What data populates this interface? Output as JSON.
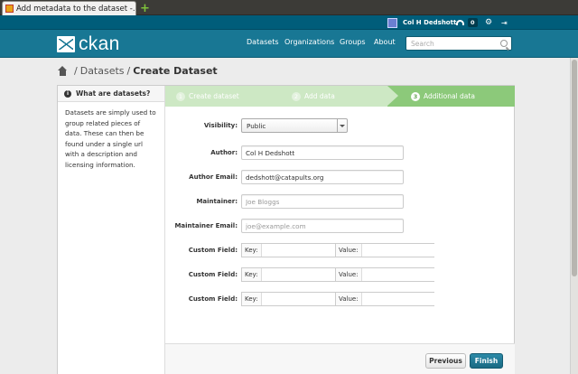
{
  "browser": {
    "tab_title": "Add metadata to the dataset -...",
    "new_tab_icon": "plus-icon"
  },
  "account": {
    "user_name": "Col H Dedshott",
    "dashboard_count": "0",
    "icons": [
      "avatar",
      "dashboard-icon",
      "gear-icon",
      "sign-out-icon"
    ]
  },
  "masthead": {
    "logo_text": "ckan",
    "nav": [
      "Datasets",
      "Organizations",
      "Groups",
      "About"
    ],
    "search_placeholder": "Search"
  },
  "breadcrumb": {
    "items": [
      "Datasets",
      "Create Dataset"
    ]
  },
  "aside": {
    "heading": "What are datasets?",
    "body": "Datasets are simply used to group related pieces of data. These can then be found under a single url with a description and licensing information."
  },
  "stages": [
    {
      "number": "1",
      "label": "Create dataset"
    },
    {
      "number": "2",
      "label": "Add data"
    },
    {
      "number": "3",
      "label": "Additional data"
    }
  ],
  "form": {
    "visibility": {
      "label": "Visibility:",
      "value": "Public"
    },
    "author": {
      "label": "Author:",
      "value": "Col H Dedshott"
    },
    "author_email": {
      "label": "Author Email:",
      "value": "dedshott@catapults.org"
    },
    "maintainer": {
      "label": "Maintainer:",
      "placeholder": "Joe Bloggs"
    },
    "maintainer_email": {
      "label": "Maintainer Email:",
      "placeholder": "joe@example.com"
    },
    "custom_fields": [
      {
        "label": "Custom Field:",
        "key_label": "Key:",
        "value_label": "Value:"
      },
      {
        "label": "Custom Field:",
        "key_label": "Key:",
        "value_label": "Value:"
      },
      {
        "label": "Custom Field:",
        "key_label": "Key:",
        "value_label": "Value:"
      }
    ]
  },
  "actions": {
    "previous": "Previous",
    "finish": "Finish"
  },
  "colors": {
    "masthead": "#187794",
    "account_bar": "#005d7a",
    "stage_active": "#8cc97a",
    "stage_inactive": "#cde8c4",
    "finish_button": "#1a6a83"
  }
}
